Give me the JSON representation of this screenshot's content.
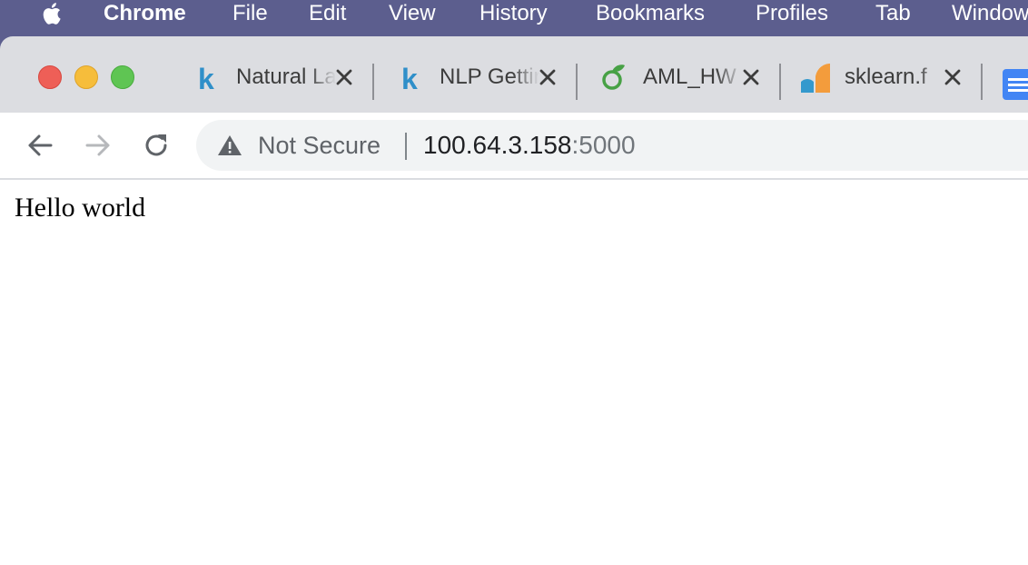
{
  "menubar": {
    "app_name": "Chrome",
    "items": [
      "File",
      "Edit",
      "View",
      "History",
      "Bookmarks",
      "Profiles",
      "Tab",
      "Window"
    ]
  },
  "tabs": [
    {
      "title": "Natural Language",
      "favicon": "kaggle-k-icon",
      "color": "#2f8fc9"
    },
    {
      "title": "NLP Getting",
      "favicon": "kaggle-k-icon",
      "color": "#2f8fc9"
    },
    {
      "title": "AML_HW",
      "favicon": "overleaf-icon",
      "color": "#47a145"
    },
    {
      "title": "sklearn.f",
      "favicon": "sklearn-icon",
      "color": "#f39c3c"
    }
  ],
  "toolbar": {
    "security_label": "Not Secure",
    "url_host": "100.64.3.158",
    "url_port": ":5000"
  },
  "page": {
    "body_text": "Hello world"
  }
}
